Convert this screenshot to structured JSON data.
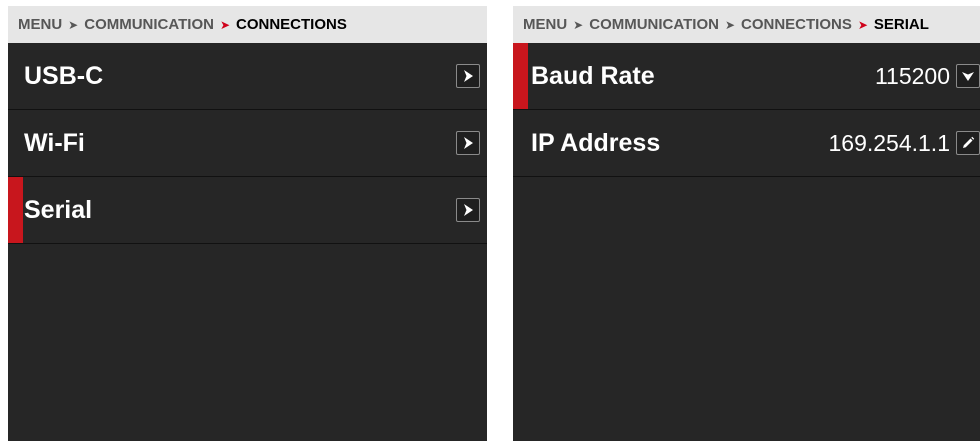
{
  "left_panel": {
    "breadcrumb": {
      "root": "MENU",
      "parent": "COMMUNICATION",
      "current": "CONNECTIONS"
    },
    "items": [
      {
        "label": "USB-C",
        "icon": "chevron-right-icon",
        "selected": false
      },
      {
        "label": "Wi-Fi",
        "icon": "chevron-right-icon",
        "selected": false
      },
      {
        "label": "Serial",
        "icon": "chevron-right-icon",
        "selected": true
      }
    ]
  },
  "right_panel": {
    "breadcrumb": {
      "root": "MENU",
      "parent": "COMMUNICATION",
      "section": "CONNECTIONS",
      "current": "SERIAL"
    },
    "settings": [
      {
        "label": "Baud Rate",
        "value": "115200",
        "icon": "chevron-down-icon",
        "selected": true
      },
      {
        "label": "IP Address",
        "value": "169.254.1.1",
        "icon": "pencil-icon",
        "selected": false
      }
    ]
  },
  "colors": {
    "accent": "#c8161d",
    "panel_bg": "#262626",
    "header_bg": "#e6e6e6"
  }
}
